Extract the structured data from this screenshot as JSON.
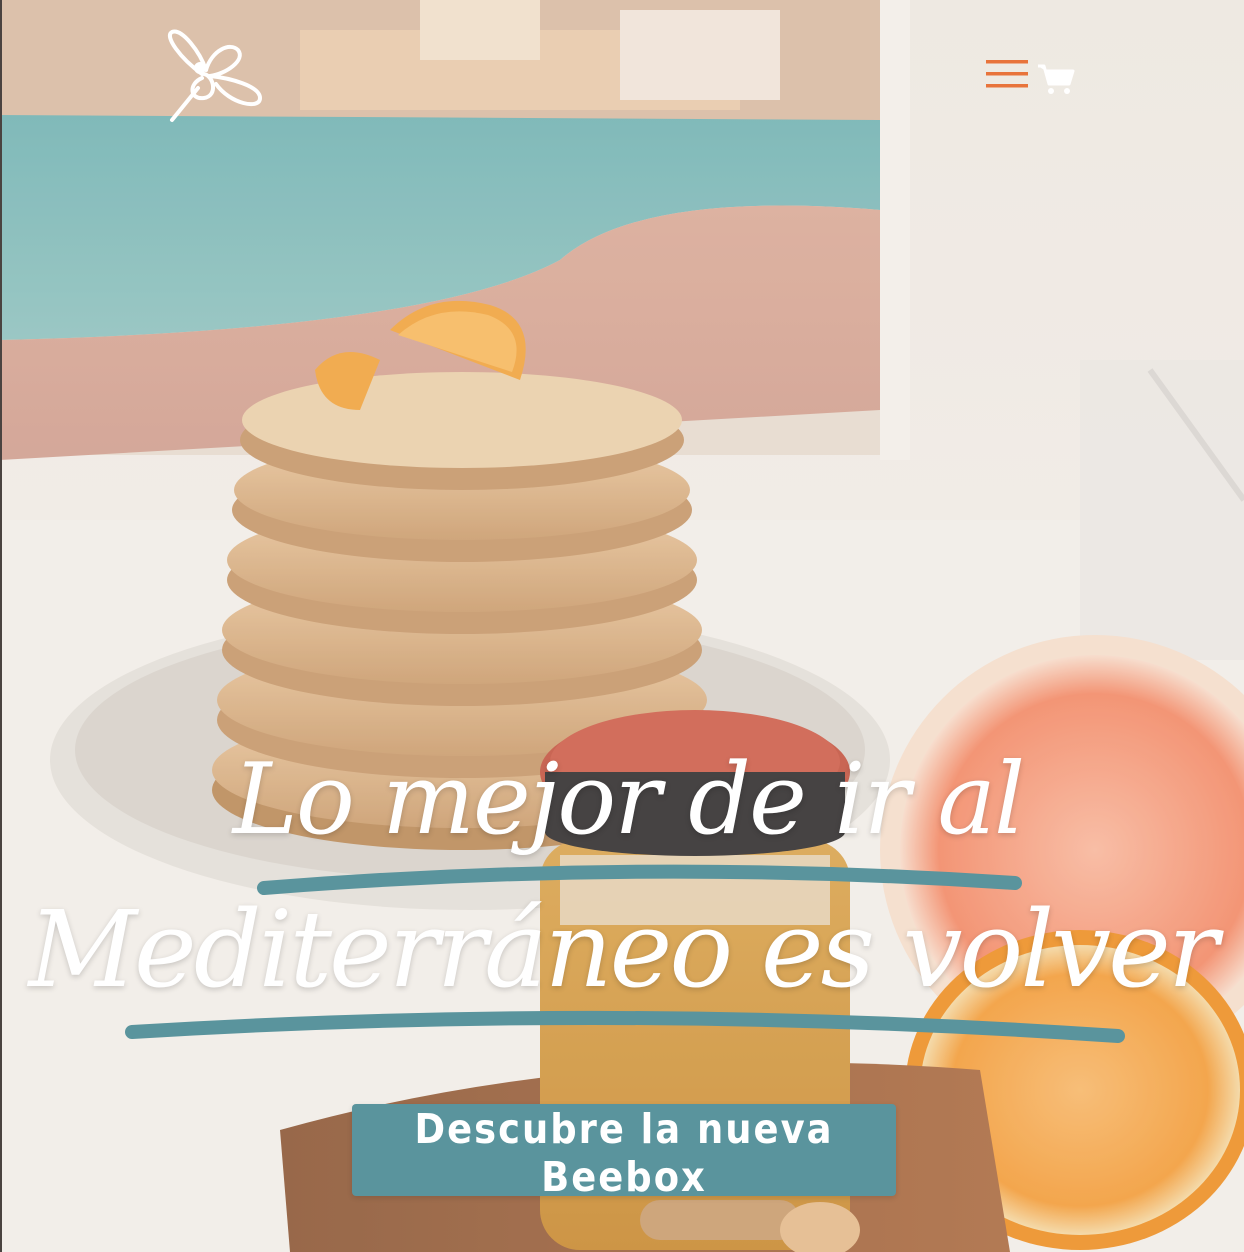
{
  "header": {
    "logo_icon": "bee-flower-logo-icon",
    "menu_icon": "hamburger-menu-icon",
    "cart_icon": "shopping-cart-icon",
    "accent_color": "#e8743b"
  },
  "hero": {
    "headline_line1": "Lo mejor de ir al",
    "headline_line2": "Mediterráneo es volver",
    "underline_color": "#5a949d",
    "cta_label": "Descubre la nueva Beebox",
    "cta_color": "#5a949d"
  }
}
